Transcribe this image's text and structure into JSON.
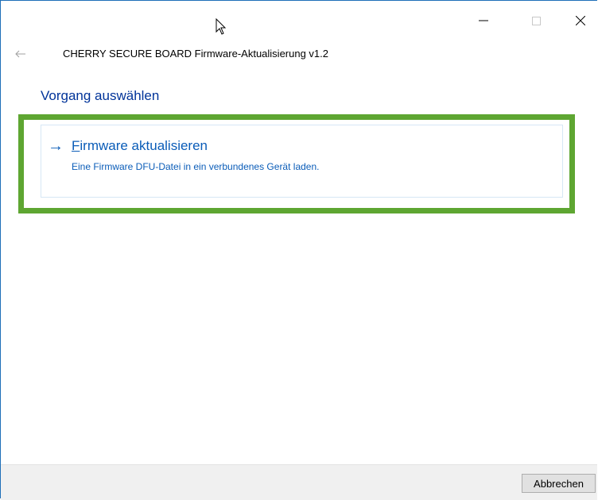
{
  "window": {
    "title": "CHERRY SECURE BOARD Firmware-Aktualisierung v1.2",
    "controls": {
      "minimize_icon": "minimize-icon",
      "maximize_icon": "maximize-icon",
      "close_icon": "close-icon"
    }
  },
  "nav": {
    "back_icon": "back-arrow-icon"
  },
  "main": {
    "heading": "Vorgang auswählen",
    "options": [
      {
        "arrow": "→",
        "title_first_letter": "F",
        "title_rest": "irmware aktualisieren",
        "description": "Eine Firmware DFU-Datei in ein verbundenes Gerät laden."
      }
    ]
  },
  "footer": {
    "cancel_label": "Abbrechen"
  },
  "colors": {
    "accent_blue": "#0a5cb8",
    "heading_blue": "#003399",
    "highlight_green": "#5ea632"
  }
}
